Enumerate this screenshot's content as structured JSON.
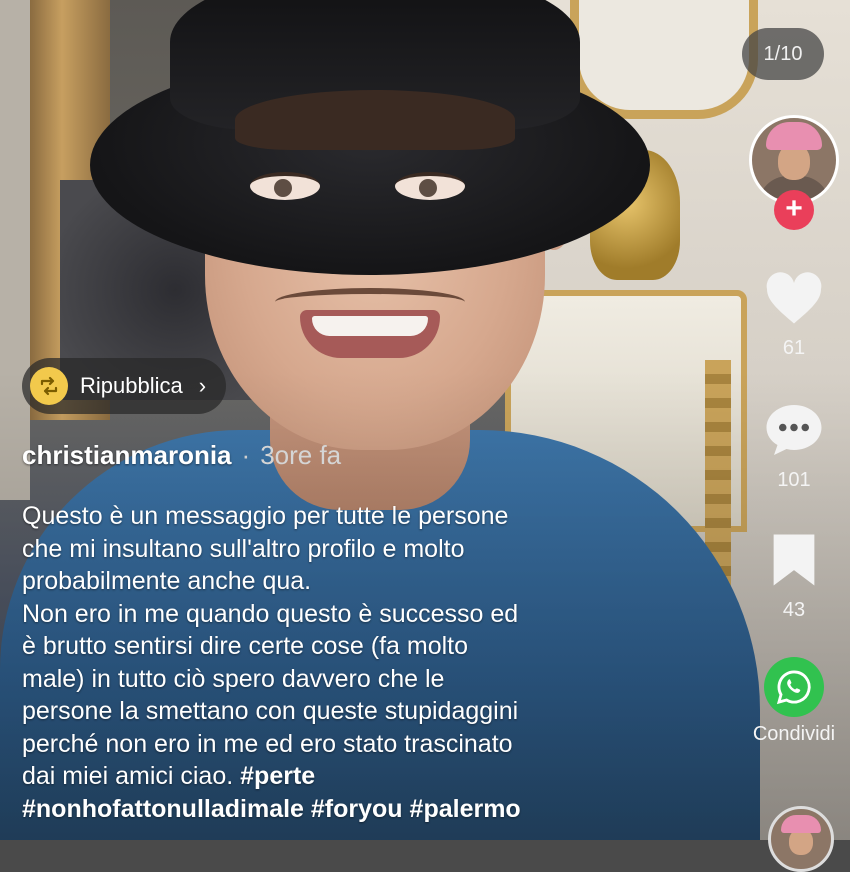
{
  "counter": "1/10",
  "repost": {
    "label": "Ripubblica",
    "chevron": "›",
    "icon": "repost-icon"
  },
  "post": {
    "username": "christianmaronia",
    "separator": "·",
    "time": "3ore fa",
    "caption_lines": [
      "Questo è un messaggio per tutte le persone",
      "che mi insultano sull'altro profilo e molto",
      "probabilmente anche qua.",
      "Non ero in me quando questo è successo ed",
      "è brutto sentirsi dire certe cose (fa molto",
      "male) in tutto ciò spero davvero che le",
      "persone la smettano con queste stupidaggini",
      "perché non ero in me ed ero stato trascinato"
    ],
    "caption_line_9_text": "dai miei amici ciao.",
    "hashtags_line_9": [
      "#perte"
    ],
    "hashtags_line_10": [
      "#nonhofattonulladimale",
      "#foryou",
      "#palermo"
    ]
  },
  "rail": {
    "follow_symbol": "+",
    "likes": "61",
    "comments": "101",
    "saves": "43",
    "share_label": "Condividi",
    "icons": [
      "heart-icon",
      "comment-icon",
      "bookmark-icon",
      "whatsapp-icon"
    ]
  },
  "colors": {
    "follow_red": "#ea3f5a",
    "repost_yellow": "#f2c94c",
    "whatsapp_green": "#31c24f"
  }
}
